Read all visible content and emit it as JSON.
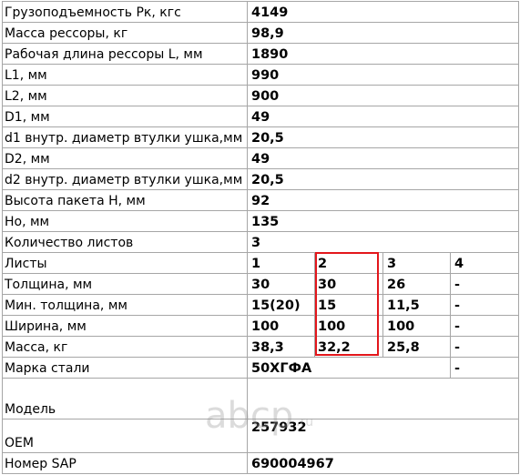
{
  "rows": [
    {
      "label": "Грузоподъемность Pк, кгс",
      "value": "4149"
    },
    {
      "label": "Масса рессоры, кг",
      "value": "98,9"
    },
    {
      "label": "Рабочая длина рессоры L, мм",
      "value": "1890"
    },
    {
      "label": "L1, мм",
      "value": "990"
    },
    {
      "label": "L2, мм",
      "value": "900"
    },
    {
      "label": "D1, мм",
      "value": "49"
    },
    {
      "label": "d1 внутр. диаметр втулки ушка,мм",
      "value": "20,5"
    },
    {
      "label": "D2, мм",
      "value": "49"
    },
    {
      "label": "d2 внутр. диаметр втулки ушка,мм",
      "value": "20,5"
    },
    {
      "label": "Высота пакета H, мм",
      "value": "92"
    },
    {
      "label": "Ho, мм",
      "value": "135"
    },
    {
      "label": "Количество листов",
      "value": "3"
    }
  ],
  "leaves": {
    "header": {
      "label": "Листы",
      "values": [
        "1",
        "2",
        "3",
        "4"
      ]
    },
    "rows": [
      {
        "label": "Толщина, мм",
        "values": [
          "30",
          "30",
          "26",
          "-"
        ]
      },
      {
        "label": "Мин. толщина, мм",
        "values": [
          "15(20)",
          "15",
          "11,5",
          "-"
        ]
      },
      {
        "label": "Ширина, мм",
        "values": [
          "100",
          "100",
          "100",
          "-"
        ]
      },
      {
        "label": "Масса, кг",
        "values": [
          "38,3",
          "32,2",
          "25,8",
          "-"
        ]
      }
    ]
  },
  "steel": {
    "label": "Марка стали",
    "value": "50ХГФА",
    "extra": "-"
  },
  "model": {
    "label": "Модель",
    "value": ""
  },
  "oem": {
    "label": "OEM",
    "value": "257932"
  },
  "sap": {
    "label": "Номер SAP",
    "value": "690004967"
  },
  "watermark": {
    "text": "abcp",
    "suffix": ".ru"
  },
  "colors": {
    "highlight": "#e3161b",
    "grid": "#a6a6a6"
  }
}
